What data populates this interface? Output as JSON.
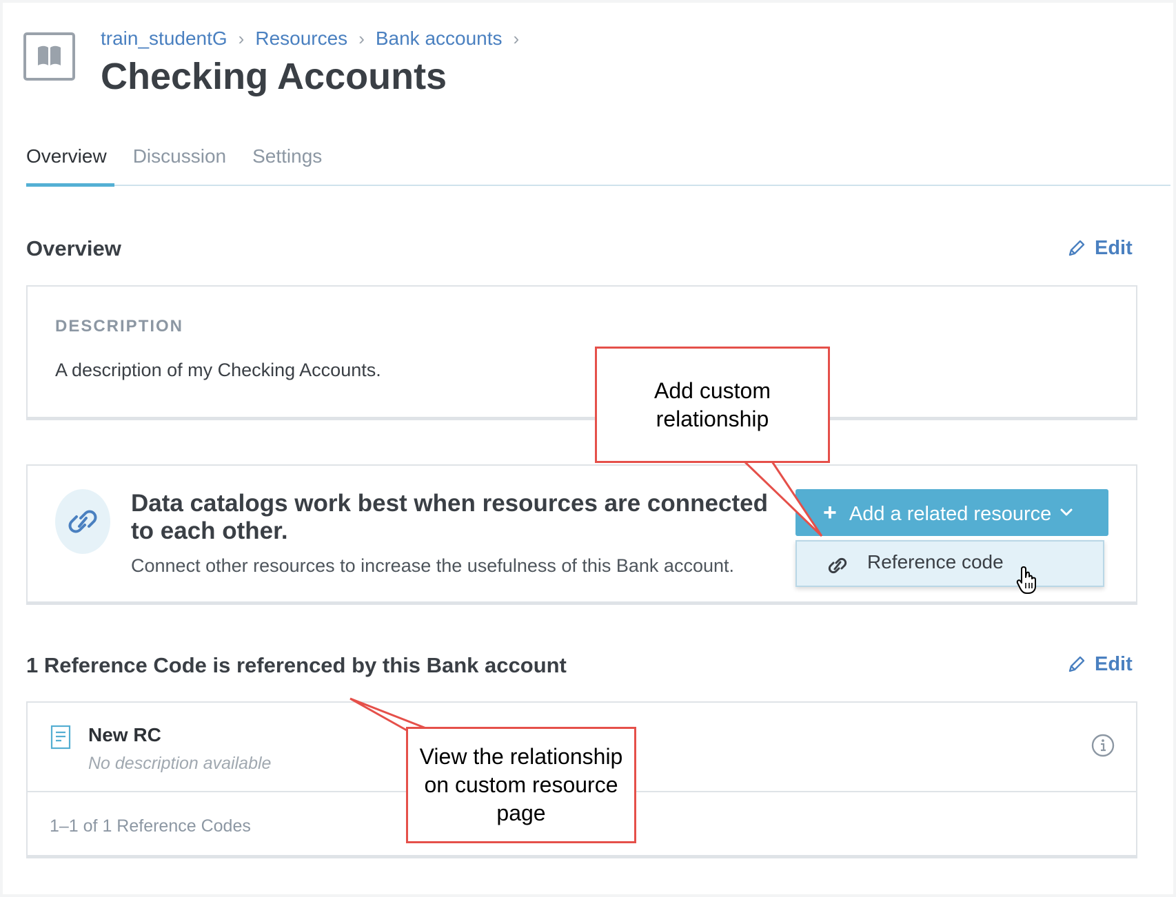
{
  "header": {
    "breadcrumb": [
      "train_studentG",
      "Resources",
      "Bank accounts"
    ],
    "title": "Checking Accounts",
    "icon": "book-icon"
  },
  "tabs": [
    {
      "label": "Overview",
      "active": true
    },
    {
      "label": "Discussion",
      "active": false
    },
    {
      "label": "Settings",
      "active": false
    }
  ],
  "overview": {
    "title": "Overview",
    "edit_label": "Edit",
    "description_label": "DESCRIPTION",
    "description": "A description of my Checking Accounts."
  },
  "connect": {
    "title": "Data catalogs work best when resources are connected to each other.",
    "subtitle": "Connect other resources to increase the usefulness of this Bank account.",
    "add_button_label": "Add a related resource",
    "dropdown_items": [
      {
        "label": "Reference code",
        "icon": "link-icon"
      }
    ]
  },
  "references": {
    "title": "1 Reference Code is referenced by this Bank account",
    "edit_label": "Edit",
    "items": [
      {
        "name": "New RC",
        "description": "No description available"
      }
    ],
    "pager": "1–1 of 1 Reference Codes"
  },
  "callouts": {
    "add_custom": [
      "Add custom",
      "relationship"
    ],
    "view_relationship": [
      "View the relationship",
      "on custom resource",
      "page"
    ]
  },
  "colors": {
    "accent": "#54aed2",
    "link": "#4a80c0",
    "callout_border": "#e5504a"
  }
}
